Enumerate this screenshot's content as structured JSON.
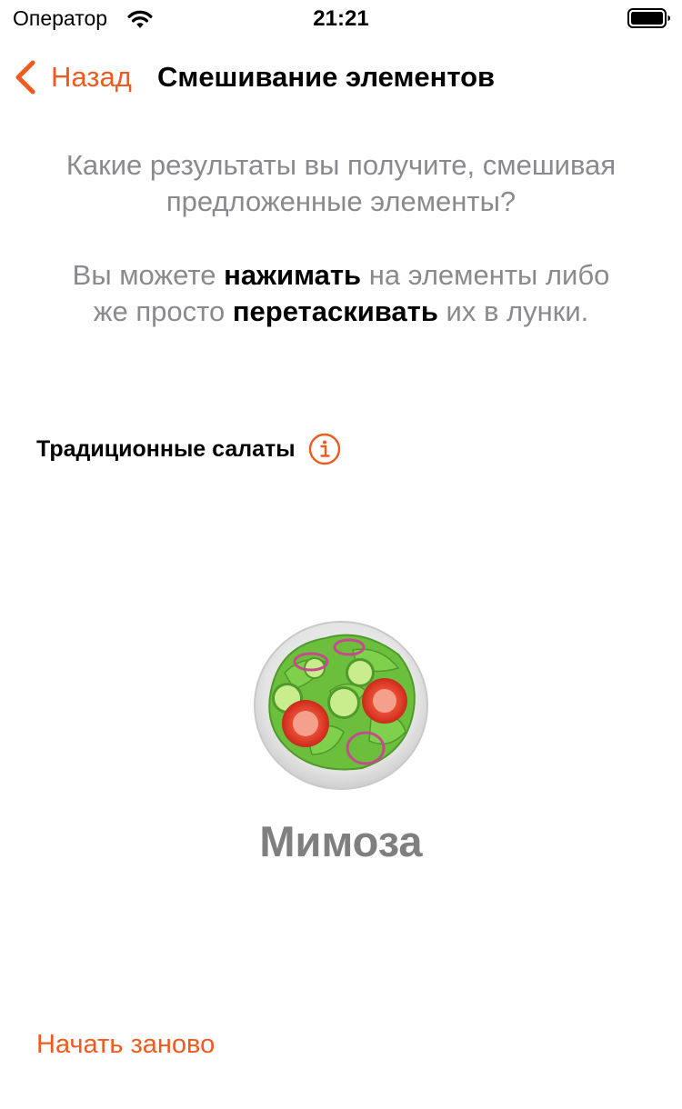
{
  "status_bar": {
    "carrier": "Оператор",
    "time": "21:21",
    "wifi_icon": "wifi-icon",
    "battery_icon": "battery-full-icon"
  },
  "nav": {
    "back_label": "Назад",
    "back_icon": "chevron-left-icon",
    "title": "Смешивание элементов"
  },
  "intro": {
    "question": "Какие результаты вы получите, смешивая предложенные элементы?",
    "hint_part1": "Вы можете ",
    "hint_bold1": "нажимать",
    "hint_part2": " на элементы либо же просто ",
    "hint_bold2": "перетаскивать",
    "hint_part3": " их в лунки."
  },
  "section": {
    "title": "Традиционные салаты",
    "info_icon": "info-circle-icon"
  },
  "result": {
    "image": "green-salad-icon",
    "name": "Мимоза"
  },
  "footer": {
    "restart_label": "Начать заново"
  },
  "colors": {
    "accent": "#f05a1f",
    "secondary_text": "#8a8a8e",
    "result_text": "#7f7f7f"
  }
}
